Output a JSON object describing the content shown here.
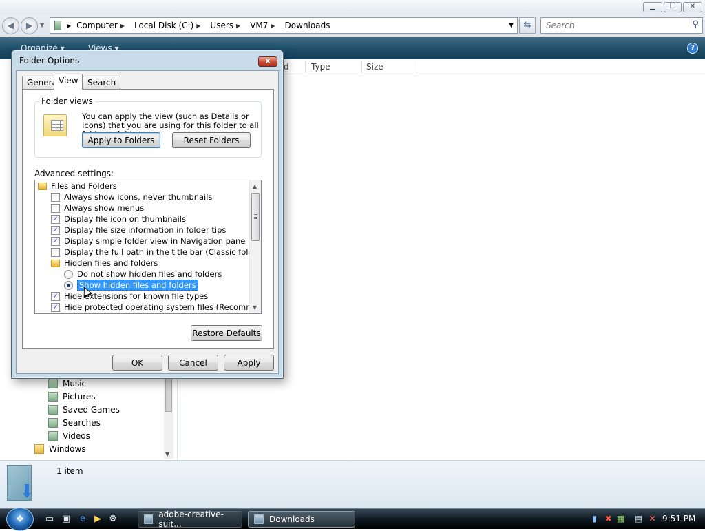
{
  "explorer": {
    "breadcrumb": [
      "Computer",
      "Local Disk (C:)",
      "Users",
      "VM7",
      "Downloads"
    ],
    "search_placeholder": "Search",
    "toolbar": {
      "organize": "Organize",
      "views": "Views"
    },
    "columns": [
      "d",
      "Type",
      "Size"
    ],
    "nav_items": [
      "Music",
      "Pictures",
      "Saved Games",
      "Searches",
      "Videos",
      "Windows"
    ],
    "status": "1 item"
  },
  "dialog": {
    "title": "Folder Options",
    "tabs": [
      "General",
      "View",
      "Search"
    ],
    "active_tab": "View",
    "folder_views": {
      "legend": "Folder views",
      "description": "You can apply the view (such as Details or Icons) that you are using for this folder to all folders of this type.",
      "apply_button": "Apply to Folders",
      "reset_button": "Reset Folders"
    },
    "advanced_label": "Advanced settings:",
    "tree": [
      {
        "kind": "folder",
        "label": "Files and Folders",
        "indent": 0
      },
      {
        "kind": "check",
        "label": "Always show icons, never thumbnails",
        "checked": false,
        "indent": 1
      },
      {
        "kind": "check",
        "label": "Always show menus",
        "checked": false,
        "indent": 1
      },
      {
        "kind": "check",
        "label": "Display file icon on thumbnails",
        "checked": true,
        "indent": 1
      },
      {
        "kind": "check",
        "label": "Display file size information in folder tips",
        "checked": true,
        "indent": 1
      },
      {
        "kind": "check",
        "label": "Display simple folder view in Navigation pane",
        "checked": true,
        "indent": 1
      },
      {
        "kind": "check",
        "label": "Display the full path in the title bar (Classic folders only)",
        "checked": false,
        "indent": 1
      },
      {
        "kind": "folder",
        "label": "Hidden files and folders",
        "indent": 1
      },
      {
        "kind": "radio",
        "label": "Do not show hidden files and folders",
        "checked": false,
        "indent": 2
      },
      {
        "kind": "radio",
        "label": "Show hidden files and folders",
        "checked": true,
        "selected": true,
        "indent": 2
      },
      {
        "kind": "check",
        "label": "Hide extensions for known file types",
        "checked": true,
        "indent": 1
      },
      {
        "kind": "check",
        "label": "Hide protected operating system files (Recommended)",
        "checked": true,
        "indent": 1
      }
    ],
    "restore_defaults": "Restore Defaults",
    "ok": "OK",
    "cancel": "Cancel",
    "apply": "Apply"
  },
  "taskbar": {
    "tasks": [
      "adobe-creative-suit...",
      "Downloads"
    ],
    "active_task": "Downloads",
    "clock": "9:51 PM"
  }
}
